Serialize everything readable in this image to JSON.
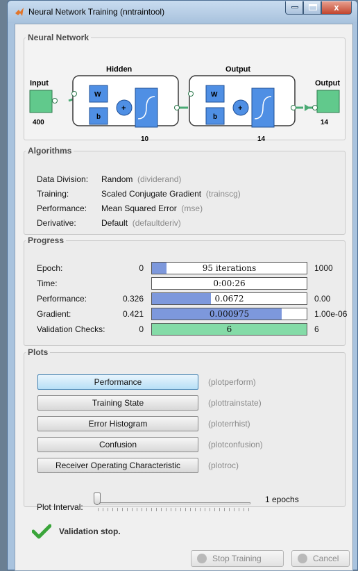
{
  "window": {
    "title": "Neural Network Training (nntraintool)"
  },
  "network": {
    "legend": "Neural Network",
    "input_label": "Input",
    "input_size": "400",
    "hidden_label": "Hidden",
    "hidden_size": "10",
    "output_layer_label": "Output",
    "output_layer_size": "14",
    "output_label": "Output",
    "output_size": "14",
    "w": "W",
    "b": "b",
    "plus": "+"
  },
  "algorithms": {
    "legend": "Algorithms",
    "rows": [
      {
        "label": "Data Division:",
        "value": "Random",
        "fn": "(dividerand)"
      },
      {
        "label": "Training:",
        "value": "Scaled Conjugate Gradient",
        "fn": "(trainscg)"
      },
      {
        "label": "Performance:",
        "value": "Mean Squared Error",
        "fn": "(mse)"
      },
      {
        "label": "Derivative:",
        "value": "Default",
        "fn": "(defaultderiv)"
      }
    ]
  },
  "progress": {
    "legend": "Progress",
    "rows": [
      {
        "label": "Epoch:",
        "start": "0",
        "current": "95 iterations",
        "end": "1000",
        "fill": 0.095
      },
      {
        "label": "Time:",
        "start": "",
        "current": "0:00:26",
        "end": "",
        "fill": 0
      },
      {
        "label": "Performance:",
        "start": "0.326",
        "current": "0.0672",
        "end": "0.00",
        "fill": 0.38
      },
      {
        "label": "Gradient:",
        "start": "0.421",
        "current": "0.000975",
        "end": "1.00e-06",
        "fill": 0.84
      },
      {
        "label": "Validation Checks:",
        "start": "0",
        "current": "6",
        "end": "6",
        "fill": 1.0
      }
    ]
  },
  "plots": {
    "legend": "Plots",
    "buttons": [
      {
        "label": "Performance",
        "fn": "(plotperform)"
      },
      {
        "label": "Training State",
        "fn": "(plottrainstate)"
      },
      {
        "label": "Error Histogram",
        "fn": "(ploterrhist)"
      },
      {
        "label": "Confusion",
        "fn": "(plotconfusion)"
      },
      {
        "label": "Receiver Operating Characteristic",
        "fn": "(plotroc)"
      }
    ],
    "interval_label": "Plot Interval:",
    "interval_value": "1 epochs"
  },
  "status": {
    "text": "Validation stop."
  },
  "footer": {
    "stop_label": "Stop Training",
    "cancel_label": "Cancel"
  },
  "colors": {
    "layer_box": "#4f8fe4",
    "io_box": "#61c98c",
    "fill_blue": "#7d98dc",
    "fill_green": "#84dba7"
  }
}
